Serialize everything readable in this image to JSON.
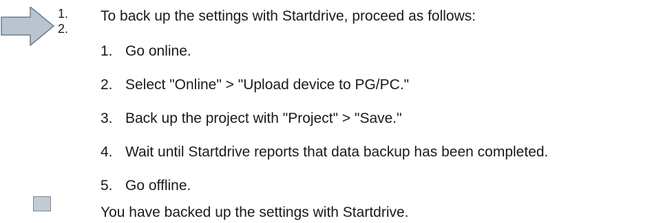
{
  "procedure": {
    "icon": "instruction-arrow-icon",
    "icon_numbers": [
      "1.",
      "2."
    ],
    "intro": "To back up the settings with Startdrive, proceed as follows:",
    "steps": [
      {
        "num": "1.",
        "text": "Go online."
      },
      {
        "num": "2.",
        "text": "Select \"Online\" > \"Upload device to PG/PC.\""
      },
      {
        "num": "3.",
        "text": "Back up the project with \"Project\" > \"Save.\""
      },
      {
        "num": "4.",
        "text": "Wait until Startdrive reports that data backup has been completed."
      },
      {
        "num": "5.",
        "text": "Go offline."
      }
    ],
    "result_icon": "result-square-icon",
    "result": "You have backed up the settings with Startdrive."
  },
  "colors": {
    "arrow_fill": "#b8c4cf",
    "arrow_stroke": "#6e7c88",
    "result_fill": "#c3cbd2",
    "text": "#1a1a1a"
  }
}
